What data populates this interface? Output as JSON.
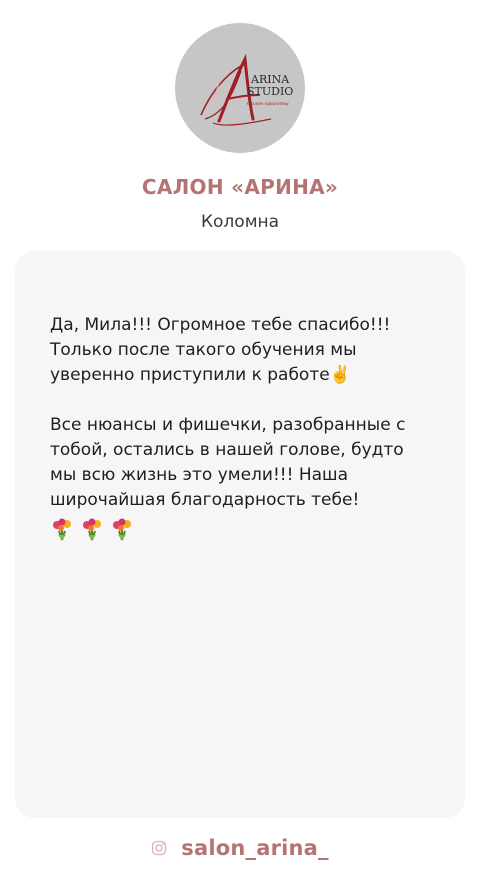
{
  "profile": {
    "logo_text_main": "ARINA",
    "logo_text_sub": "STUDIO",
    "logo_script": "Салон красоты",
    "name": "САЛОН «АРИНА»",
    "city": "Коломна"
  },
  "review": {
    "paragraph1": [
      "Да, Мила!!! Огромное тебе спасибо!!!",
      "Только после такого обучения мы",
      "уверенно приступили к работе✌️"
    ],
    "paragraph2": [
      "Все нюансы и фишечки, разобранные с",
      "тобой, остались в нашей голове, будто",
      "мы всю жизнь это умели!!! Наша",
      "широчайшая благодарность тебе!"
    ],
    "emojis": [
      "bouquet-icon",
      "bouquet-icon",
      "bouquet-icon"
    ]
  },
  "footer": {
    "icon": "instagram-icon",
    "handle": "salon_arina_"
  },
  "colors": {
    "accent": "#b47474",
    "card_bg": "#f6f6f6",
    "avatar_bg": "#c6c6c6",
    "logo_red": "#a01e24"
  }
}
